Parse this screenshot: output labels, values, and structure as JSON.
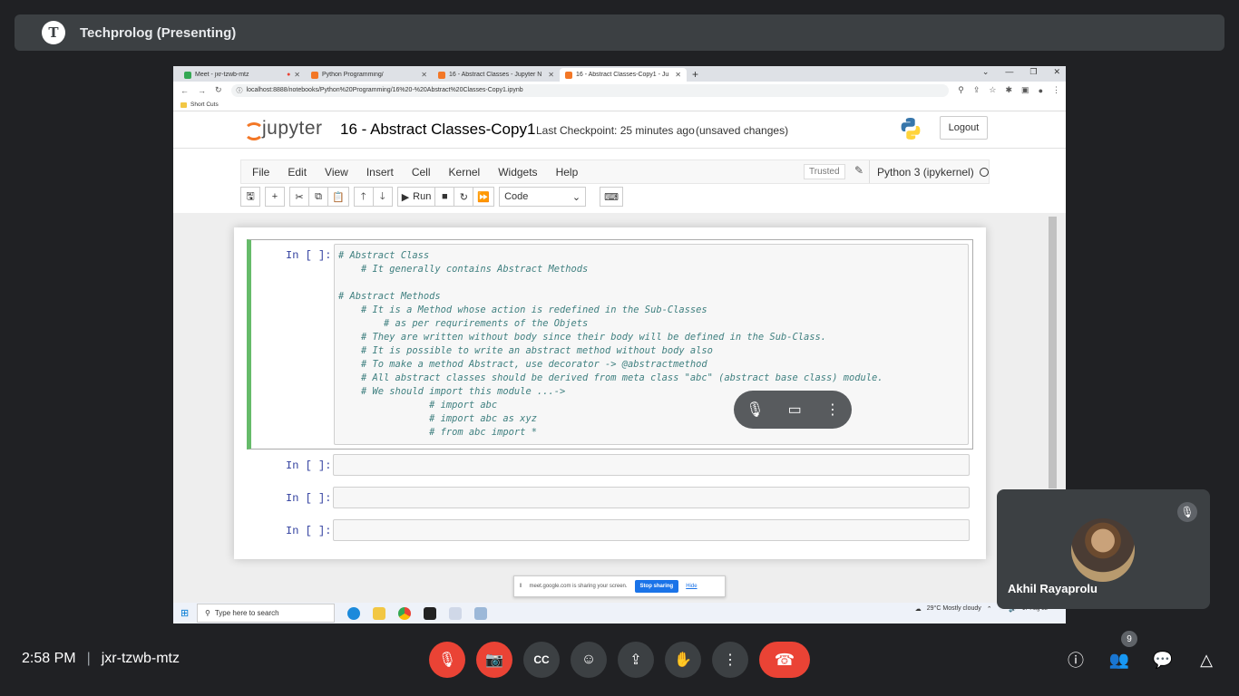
{
  "meet": {
    "presenter_title": "Techprolog (Presenting)",
    "time": "2:58 PM",
    "meeting_code": "jxr-tzwb-mtz",
    "participants_count": "9",
    "self_name": "Akhil Rayaprolu",
    "share_notice": {
      "text": "meet.google.com is sharing your screen.",
      "stop_label": "Stop sharing",
      "hide_label": "Hide"
    }
  },
  "browser": {
    "tabs": [
      {
        "label": "Meet - jxr-tzwb-mtz",
        "color": "#34a853"
      },
      {
        "label": "Python Programming/",
        "color": "#f37726"
      },
      {
        "label": "16 - Abstract Classes - Jupyter N",
        "color": "#f37726"
      },
      {
        "label": "16 - Abstract Classes-Copy1 - Ju",
        "color": "#f37726"
      }
    ],
    "url": "localhost:8888/notebooks/Python%20Programming/16%20-%20Abstract%20Classes-Copy1.ipynb",
    "bookmark": "Short Cuts"
  },
  "jupyter": {
    "logo_text": "jupyter",
    "notebook_name": "16 - Abstract Classes-Copy1",
    "checkpoint": "Last Checkpoint: 25 minutes ago",
    "status": "(unsaved changes)",
    "logout": "Logout",
    "menu": [
      "File",
      "Edit",
      "View",
      "Insert",
      "Cell",
      "Kernel",
      "Widgets",
      "Help"
    ],
    "trusted": "Trusted",
    "kernel": "Python 3 (ipykernel)",
    "run_label": "Run",
    "cell_type": "Code",
    "prompt": "In [ ]:",
    "code_lines": [
      "# Abstract Class",
      "    # It generally contains Abstract Methods",
      "",
      "# Abstract Methods",
      "    # It is a Method whose action is redefined in the Sub-Classes",
      "        # as per requrirements of the Objets",
      "    # They are written without body since their body will be defined in the Sub-Class.",
      "    # It is possible to write an abstract method without body also",
      "    # To make a method Abstract, use decorator -> @abstractmethod",
      "    # All abstract classes should be derived from meta class \"abc\" (abstract base class) module.",
      "    # We should import this module ...->",
      "                # import abc",
      "                # import abc as xyz",
      "                # from abc import *"
    ]
  },
  "taskbar": {
    "search_placeholder": "Type here to search",
    "weather": "29°C  Mostly cloudy",
    "date": "17-Aug-23"
  },
  "colors": {
    "meet_bg": "#202124",
    "meet_panel": "#3c4043",
    "red": "#ea4335",
    "jupyter_orange": "#f37726",
    "cell_selected": "#66bb6a"
  }
}
